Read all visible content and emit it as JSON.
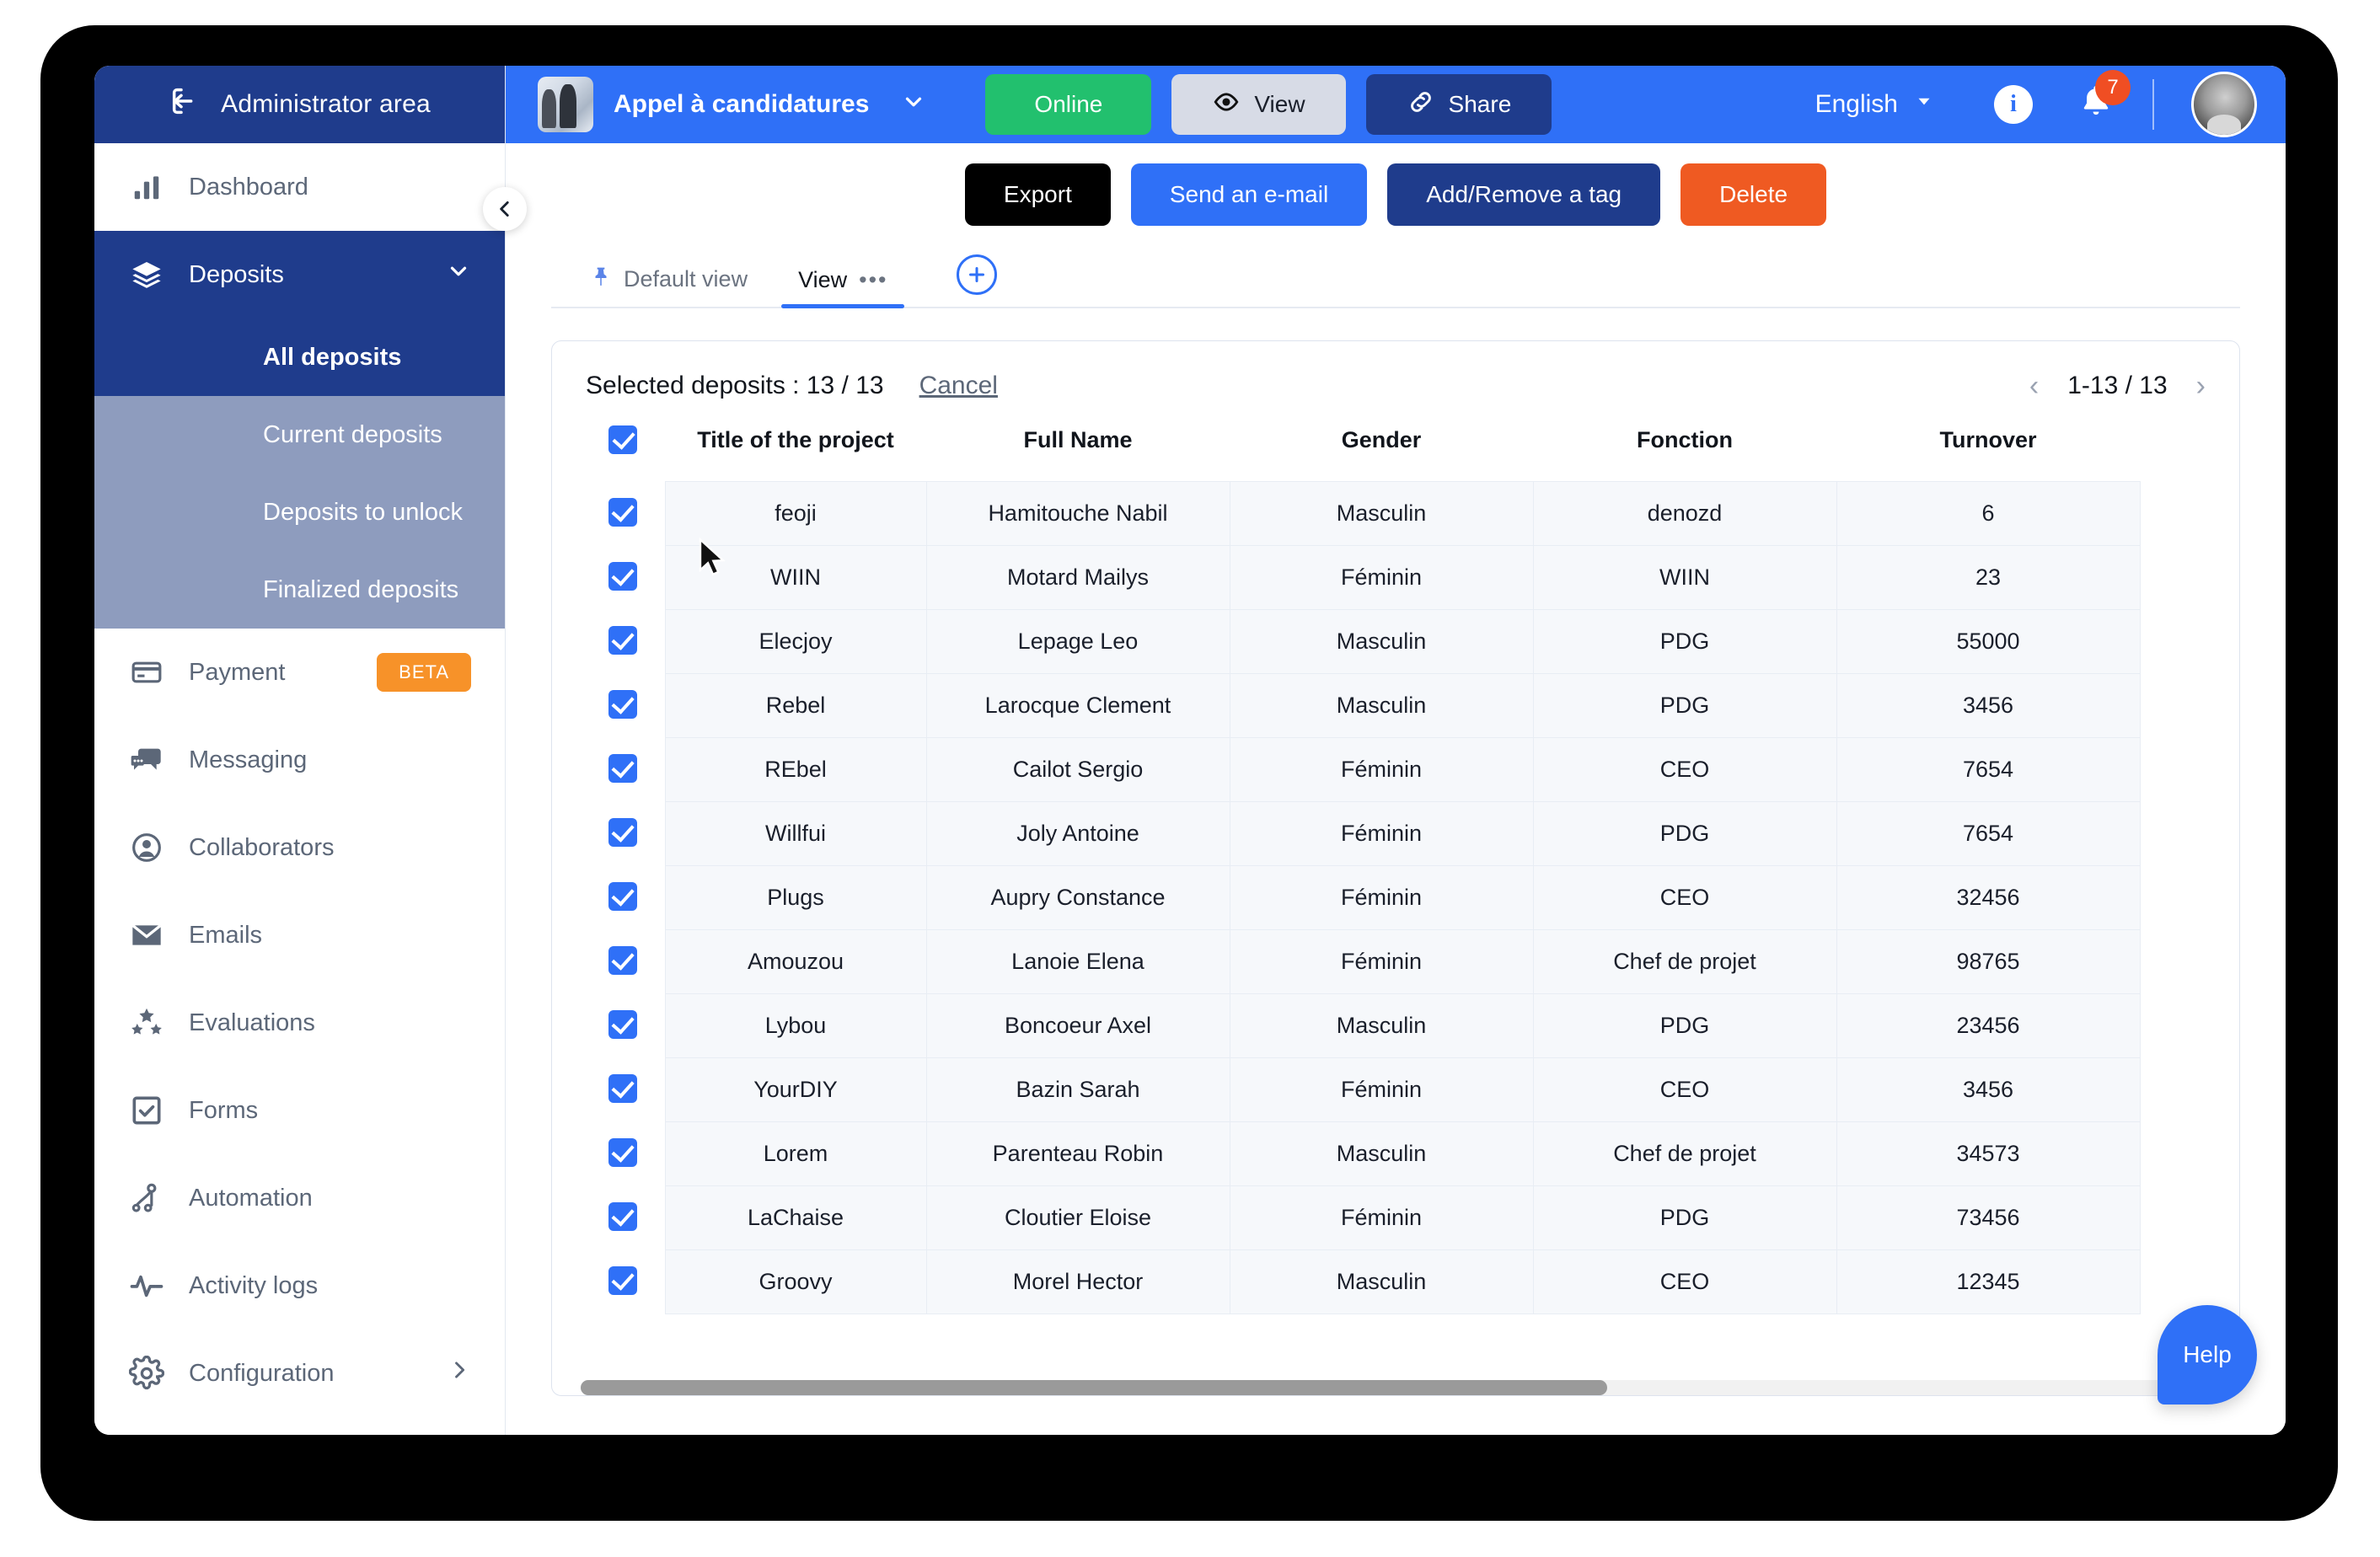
{
  "sidebar": {
    "admin_label": "Administrator area",
    "admin_icon": "logout-arrow-icon",
    "collapse_icon": "chevron-left-icon",
    "items": [
      {
        "label": "Dashboard",
        "icon": "bar-chart-icon",
        "state": "normal"
      },
      {
        "label": "Deposits",
        "icon": "layers-icon",
        "state": "active",
        "chevron": "⌄"
      },
      {
        "label": "Payment",
        "icon": "credit-card-icon",
        "state": "normal",
        "badge": "BETA"
      },
      {
        "label": "Messaging",
        "icon": "chat-bubbles-icon",
        "state": "normal"
      },
      {
        "label": "Collaborators",
        "icon": "user-circle-icon",
        "state": "normal"
      },
      {
        "label": "Emails",
        "icon": "envelope-icon",
        "state": "normal"
      },
      {
        "label": "Evaluations",
        "icon": "stars-icon",
        "state": "normal"
      },
      {
        "label": "Forms",
        "icon": "checkbox-icon",
        "state": "normal"
      },
      {
        "label": "Automation",
        "icon": "automation-icon",
        "state": "normal"
      },
      {
        "label": "Activity logs",
        "icon": "pulse-icon",
        "state": "normal"
      },
      {
        "label": "Configuration",
        "icon": "gear-icon",
        "state": "normal",
        "chevron": "›"
      }
    ],
    "subitems": [
      {
        "label": "All deposits",
        "selected": true
      },
      {
        "label": "Current deposits",
        "selected": false
      },
      {
        "label": "Deposits to unlock",
        "selected": false
      },
      {
        "label": "Finalized deposits",
        "selected": false
      }
    ]
  },
  "topbar": {
    "project_name": "Appel à candidatures",
    "project_caret": "▾",
    "online_label": "Online",
    "view_label": "View",
    "view_icon": "eye-icon",
    "share_label": "Share",
    "share_icon": "link-icon",
    "language": "English",
    "language_caret": "▾",
    "info_icon": "info-icon",
    "info_glyph": "i",
    "bell_icon": "bell-icon",
    "bell_glyph": "🔔",
    "notification_count": "7",
    "avatar": "user-avatar"
  },
  "actions": {
    "export": "Export",
    "send_email": "Send an e-mail",
    "add_remove_tag": "Add/Remove a tag",
    "delete": "Delete"
  },
  "tabs": {
    "default_view": "Default view",
    "pin_icon": "pin-icon",
    "view": "View",
    "more_dots": "•••",
    "add_icon": "plus-circle-icon",
    "add_glyph": "+"
  },
  "table_panel": {
    "selected_label": "Selected deposits : 13 / 13",
    "cancel_label": "Cancel",
    "pager_prev": "‹",
    "pager_range": "1-13 / 13",
    "pager_next": "›",
    "headers": [
      "",
      "Title of the project",
      "Full Name",
      "Gender",
      "Fonction",
      "Turnover"
    ],
    "rows": [
      {
        "checked": true,
        "title": "feoji",
        "name": "Hamitouche Nabil",
        "gender": "Masculin",
        "fonction": "denozd",
        "turnover": "6"
      },
      {
        "checked": true,
        "title": "WIIN",
        "name": "Motard Mailys",
        "gender": "Féminin",
        "fonction": "WIIN",
        "turnover": "23"
      },
      {
        "checked": true,
        "title": "Elecjoy",
        "name": "Lepage Leo",
        "gender": "Masculin",
        "fonction": "PDG",
        "turnover": "55000"
      },
      {
        "checked": true,
        "title": "Rebel",
        "name": "Larocque Clement",
        "gender": "Masculin",
        "fonction": "PDG",
        "turnover": "3456"
      },
      {
        "checked": true,
        "title": "REbel",
        "name": "Cailot Sergio",
        "gender": "Féminin",
        "fonction": "CEO",
        "turnover": "7654"
      },
      {
        "checked": true,
        "title": "Willfui",
        "name": "Joly Antoine",
        "gender": "Féminin",
        "fonction": "PDG",
        "turnover": "7654"
      },
      {
        "checked": true,
        "title": "Plugs",
        "name": "Aupry Constance",
        "gender": "Féminin",
        "fonction": "CEO",
        "turnover": "32456"
      },
      {
        "checked": true,
        "title": "Amouzou",
        "name": "Lanoie Elena",
        "gender": "Féminin",
        "fonction": "Chef de projet",
        "turnover": "98765"
      },
      {
        "checked": true,
        "title": "Lybou",
        "name": "Boncoeur Axel",
        "gender": "Masculin",
        "fonction": "PDG",
        "turnover": "23456"
      },
      {
        "checked": true,
        "title": "YourDIY",
        "name": "Bazin Sarah",
        "gender": "Féminin",
        "fonction": "CEO",
        "turnover": "3456"
      },
      {
        "checked": true,
        "title": "Lorem",
        "name": "Parenteau Robin",
        "gender": "Masculin",
        "fonction": "Chef de projet",
        "turnover": "34573"
      },
      {
        "checked": true,
        "title": "LaChaise",
        "name": "Cloutier Eloise",
        "gender": "Féminin",
        "fonction": "PDG",
        "turnover": "73456"
      },
      {
        "checked": true,
        "title": "Groovy",
        "name": "Morel Hector",
        "gender": "Masculin",
        "fonction": "CEO",
        "turnover": "12345"
      }
    ]
  },
  "help": {
    "label": "Help"
  },
  "colors": {
    "brand_blue": "#2f70f7",
    "navy": "#1f3c8c",
    "green": "#22c06e",
    "orange_delete": "#ef5a22",
    "orange_beta": "#f79229",
    "badge_red": "#f04e23",
    "row_bg": "#f6f8fb"
  }
}
